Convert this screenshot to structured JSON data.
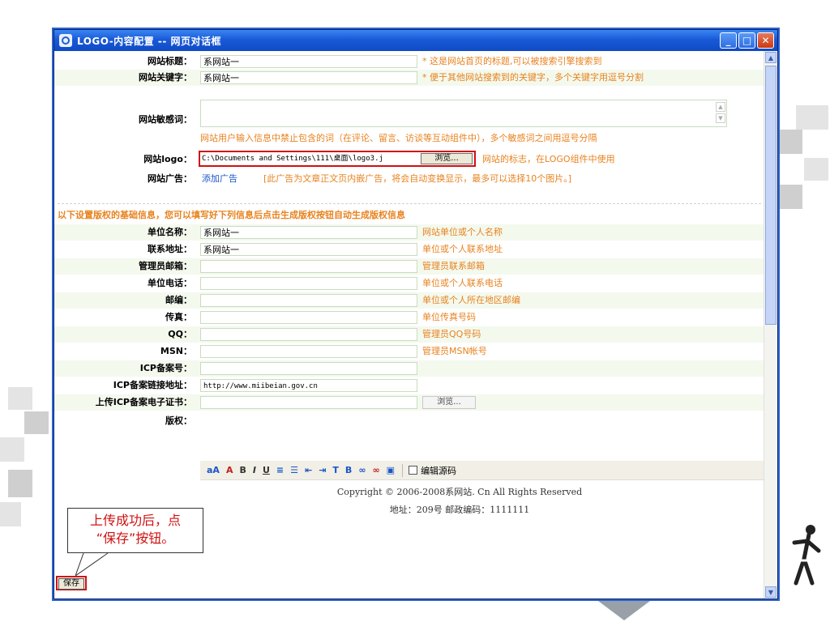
{
  "window": {
    "title": "LOGO-内容配置 -- 网页对话框",
    "minimize": "_",
    "maximize": "□",
    "close": "✕"
  },
  "fields": {
    "site_title": {
      "label": "网站标题：",
      "value": "系网站一",
      "hint": "这是网站首页的标题,可以被搜索引擎搜索到"
    },
    "site_keywords": {
      "label": "网站关键字：",
      "value": "系网站一",
      "hint": "便于其他网站搜索到的关键字，多个关键字用逗号分割"
    },
    "site_sensitive": {
      "label": "网站敏感词：",
      "value": "",
      "hint": "网站用户输入信息中禁止包含的词（在评论、留言、访谈等互动组件中），多个敏感词之间用逗号分隔"
    },
    "site_logo": {
      "label": "网站logo：",
      "value": "C:\\Documents and Settings\\111\\桌面\\logo3.j",
      "browse": "浏览...",
      "hint": "网站的标志，在LOGO组件中使用"
    },
    "site_ad": {
      "label": "网站广告：",
      "link": "添加广告",
      "hint": "[此广告为文章正文页内嵌广告，将会自动变换显示，最多可以选择10个图片。]"
    }
  },
  "section_title": "以下设置版权的基础信息，您可以填写好下列信息后点击生成版权按钮自动生成版权信息",
  "copyright_fields": [
    {
      "label": "单位名称：",
      "value": "系网站一",
      "hint": "网站单位或个人名称"
    },
    {
      "label": "联系地址：",
      "value": "系网站一",
      "hint": "单位或个人联系地址"
    },
    {
      "label": "管理员邮箱：",
      "value": "",
      "hint": "管理员联系邮箱"
    },
    {
      "label": "单位电话：",
      "value": "",
      "hint": "单位或个人联系电话"
    },
    {
      "label": "邮编：",
      "value": "",
      "hint": "单位或个人所在地区邮编"
    },
    {
      "label": "传真：",
      "value": "",
      "hint": "单位传真号码"
    },
    {
      "label": "QQ：",
      "value": "",
      "hint": "管理员QQ号码"
    },
    {
      "label": "MSN：",
      "value": "",
      "hint": "管理员MSN帐号"
    },
    {
      "label": "ICP备案号：",
      "value": "",
      "hint": ""
    },
    {
      "label": "ICP备案链接地址：",
      "value": "http://www.miibeian.gov.cn",
      "hint": ""
    }
  ],
  "upload_cert": {
    "label": "上传ICP备案电子证书：",
    "browse": "浏览..."
  },
  "copyright": {
    "label": "版权：",
    "edit_source": "编辑源码",
    "line1": "Copyright © 2006-2008系网站. Cn All Rights Reserved",
    "line2": "地址：209号 邮政编码：1111111"
  },
  "callout": {
    "line1": "上传成功后，点",
    "line2": "“保存”按钮。"
  },
  "save_label": "保存"
}
